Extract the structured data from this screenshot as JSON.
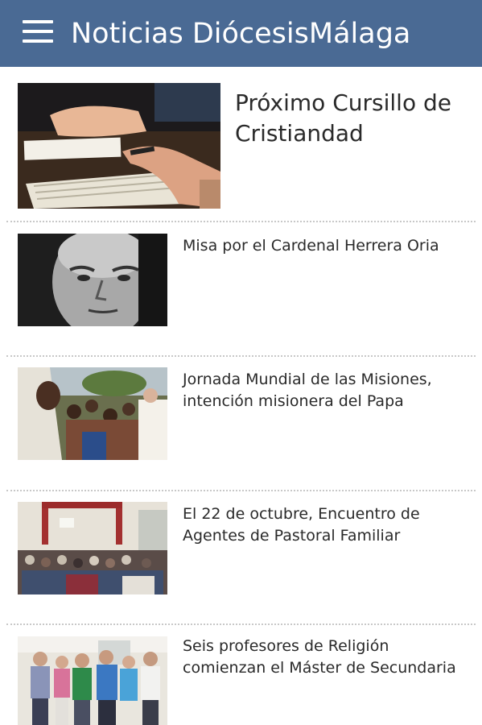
{
  "header": {
    "title": "Noticias DiócesisMálaga",
    "menu_icon": "hamburger-menu-icon",
    "background_color": "#4a6a94"
  },
  "news": [
    {
      "title": "Próximo Cursillo de Cristiandad",
      "image": "bible-reading-photo"
    },
    {
      "title": "Misa por el Cardenal Herrera Oria",
      "image": "cardinal-portrait-photo"
    },
    {
      "title": "Jornada Mundial de las Misiones, intención misionera del Papa",
      "image": "pope-missions-photo"
    },
    {
      "title": "El 22 de octubre, Encuentro de Agentes de Pastoral Familiar",
      "image": "assembly-hall-photo"
    },
    {
      "title": "Seis profesores de Religión comienzan el Máster de Secundaria",
      "image": "teachers-group-photo"
    }
  ]
}
